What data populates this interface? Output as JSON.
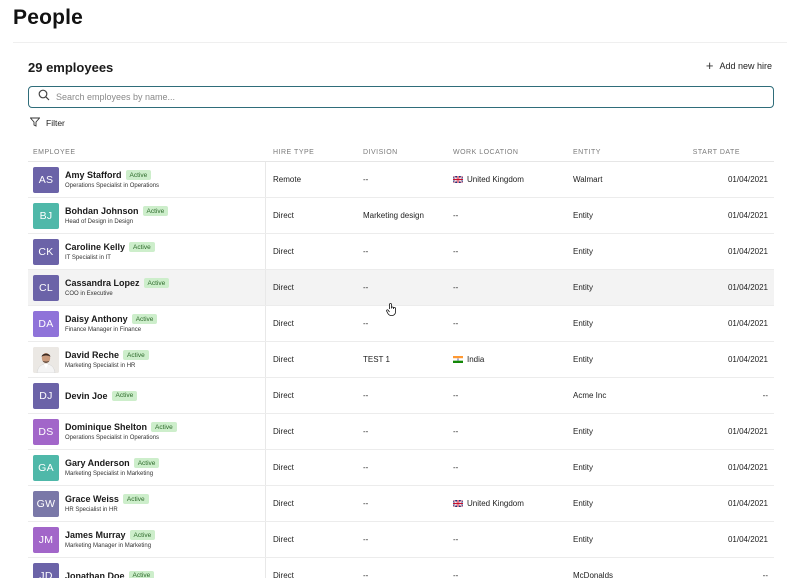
{
  "page": {
    "title": "People"
  },
  "summary": {
    "count": "29 employees",
    "add_label": "Add new hire"
  },
  "search": {
    "placeholder": "Search employees by name..."
  },
  "filter": {
    "label": "Filter"
  },
  "columns": [
    "EMPLOYEE",
    "HIRE TYPE",
    "DIVISION",
    "WORK LOCATION",
    "ENTITY",
    "START DATE"
  ],
  "rows": [
    {
      "initials": "AS",
      "color": "#6b63a8",
      "name": "Amy Stafford",
      "status": "Active",
      "role": "Operations Specialist in Operations",
      "hire_type": "Remote",
      "division": "--",
      "location": "United Kingdom",
      "flag": "uk",
      "entity": "Walmart",
      "start": "01/04/2021"
    },
    {
      "initials": "BJ",
      "color": "#4fb8a9",
      "name": "Bohdan Johnson",
      "status": "Active",
      "role": "Head of Design in Design",
      "hire_type": "Direct",
      "division": "Marketing design",
      "location": "--",
      "flag": "",
      "entity": "Entity",
      "start": "01/04/2021"
    },
    {
      "initials": "CK",
      "color": "#6b63a8",
      "name": "Caroline Kelly",
      "status": "Active",
      "role": "IT Specialist in IT",
      "hire_type": "Direct",
      "division": "--",
      "location": "--",
      "flag": "",
      "entity": "Entity",
      "start": "01/04/2021"
    },
    {
      "initials": "CL",
      "color": "#6b63a8",
      "name": "Cassandra Lopez",
      "status": "Active",
      "role": "COO in Executive",
      "hire_type": "Direct",
      "division": "--",
      "location": "--",
      "flag": "",
      "entity": "Entity",
      "start": "01/04/2021"
    },
    {
      "initials": "DA",
      "color": "#8f73d9",
      "name": "Daisy Anthony",
      "status": "Active",
      "role": "Finance Manager in Finance",
      "hire_type": "Direct",
      "division": "--",
      "location": "--",
      "flag": "",
      "entity": "Entity",
      "start": "01/04/2021"
    },
    {
      "initials": "",
      "color": "",
      "name": "David Reche",
      "status": "Active",
      "role": "Marketing Specialist in HR",
      "hire_type": "Direct",
      "division": "TEST 1",
      "location": "India",
      "flag": "in",
      "entity": "Entity",
      "start": "01/04/2021"
    },
    {
      "initials": "DJ",
      "color": "#6b63a8",
      "name": "Devin Joe",
      "status": "Active",
      "role": "",
      "hire_type": "Direct",
      "division": "--",
      "location": "--",
      "flag": "",
      "entity": "Acme Inc",
      "start": "--"
    },
    {
      "initials": "DS",
      "color": "#a266c9",
      "name": "Dominique Shelton",
      "status": "Active",
      "role": "Operations Specialist in Operations",
      "hire_type": "Direct",
      "division": "--",
      "location": "--",
      "flag": "",
      "entity": "Entity",
      "start": "01/04/2021"
    },
    {
      "initials": "GA",
      "color": "#4fb8a9",
      "name": "Gary Anderson",
      "status": "Active",
      "role": "Marketing Specialist in Marketing",
      "hire_type": "Direct",
      "division": "--",
      "location": "--",
      "flag": "",
      "entity": "Entity",
      "start": "01/04/2021"
    },
    {
      "initials": "GW",
      "color": "#7a78a8",
      "name": "Grace Weiss",
      "status": "Active",
      "role": "HR Specialist in HR",
      "hire_type": "Direct",
      "division": "--",
      "location": "United Kingdom",
      "flag": "uk",
      "entity": "Entity",
      "start": "01/04/2021"
    },
    {
      "initials": "JM",
      "color": "#a266c9",
      "name": "James Murray",
      "status": "Active",
      "role": "Marketing Manager in Marketing",
      "hire_type": "Direct",
      "division": "--",
      "location": "--",
      "flag": "",
      "entity": "Entity",
      "start": "01/04/2021"
    },
    {
      "initials": "JD",
      "color": "#6b63a8",
      "name": "Jonathan Doe",
      "status": "Active",
      "role": "",
      "hire_type": "Direct",
      "division": "--",
      "location": "--",
      "flag": "",
      "entity": "McDonalds",
      "start": "--"
    }
  ]
}
